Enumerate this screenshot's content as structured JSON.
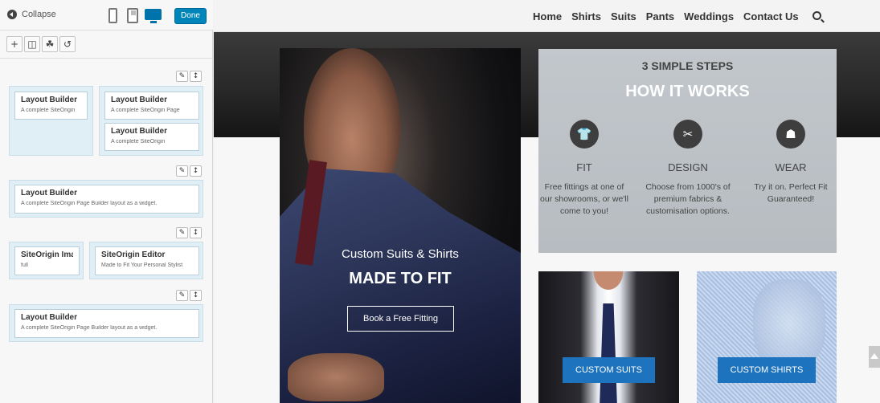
{
  "builder": {
    "collapse_label": "Collapse",
    "done_label": "Done",
    "devices": [
      "phone-icon",
      "tablet-icon",
      "desktop-icon"
    ],
    "toolbar": [
      "add-icon",
      "columns-icon",
      "layout-icon",
      "history-icon"
    ],
    "row_controls": [
      "wrench-icon",
      "move-icon"
    ],
    "rows": [
      {
        "cells": [
          [
            {
              "title": "Layout Builder",
              "desc": "A complete SiteOrigin"
            }
          ],
          [
            {
              "title": "Layout Builder",
              "desc": "A complete SiteOrigin Page"
            },
            {
              "title": "Layout Builder",
              "desc": "A complete SiteOrigin"
            }
          ]
        ]
      },
      {
        "cells": [
          [
            {
              "title": "Layout Builder",
              "desc": "A complete SiteOrigin Page Builder layout as a widget."
            }
          ]
        ]
      },
      {
        "cells": [
          [
            {
              "title": "SiteOrigin Image",
              "desc": "full"
            }
          ],
          [
            {
              "title": "SiteOrigin Editor",
              "desc": "Made to Fit Your Personal Stylist"
            }
          ]
        ]
      },
      {
        "cells": [
          [
            {
              "title": "Layout Builder",
              "desc": "A complete SiteOrigin Page Builder layout as a widget."
            }
          ]
        ]
      }
    ]
  },
  "site": {
    "nav": [
      "Home",
      "Shirts",
      "Suits",
      "Pants",
      "Weddings",
      "Contact Us"
    ],
    "hero": {
      "subtitle": "Custom Suits & Shirts",
      "title": "MADE TO FIT",
      "button": "Book a Free Fitting"
    },
    "how": {
      "kicker": "3 SIMPLE STEPS",
      "heading": "HOW IT WORKS",
      "steps": [
        {
          "icon": "tshirt-icon",
          "title": "FIT",
          "desc": "Free fittings at one of our showrooms, or we'll come to you!"
        },
        {
          "icon": "scissors-icon",
          "title": "DESIGN",
          "desc": "Choose from 1000's of premium fabrics & customisation options."
        },
        {
          "icon": "wear-icon",
          "title": "WEAR",
          "desc": "Try it on. Perfect Fit Guaranteed!"
        }
      ]
    },
    "tiles": [
      {
        "button": "CUSTOM SUITS"
      },
      {
        "button": "CUSTOM SHIRTS"
      }
    ]
  },
  "colors": {
    "accent": "#0085ba",
    "tile_button": "#1e73be",
    "cell_bg": "#e0eef5"
  }
}
